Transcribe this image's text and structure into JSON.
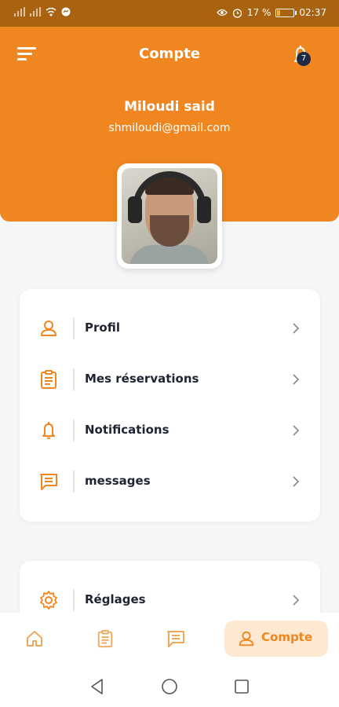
{
  "status_bar": {
    "battery_percent": "17 %",
    "battery_level": 0.17,
    "time": "02:37",
    "left_icons": [
      "signal-icon",
      "signal-icon",
      "wifi-icon",
      "messenger-icon"
    ],
    "right_icons": [
      "eye-icon",
      "alarm-icon"
    ]
  },
  "header": {
    "title": "Compte",
    "notification_count": "7",
    "user_name": "Miloudi said",
    "user_email": "shmiloudi@gmail.com"
  },
  "menu": {
    "items": [
      {
        "label": "Profil",
        "icon": "user-icon"
      },
      {
        "label": "Mes réservations",
        "icon": "clipboard-icon"
      },
      {
        "label": "Notifications",
        "icon": "bell-icon"
      },
      {
        "label": "messages",
        "icon": "message-icon"
      }
    ]
  },
  "settings": {
    "items": [
      {
        "label": "Réglages",
        "icon": "gear-icon"
      }
    ]
  },
  "bottom_nav": {
    "items": [
      {
        "icon": "home-icon"
      },
      {
        "icon": "clipboard-icon"
      },
      {
        "icon": "message-icon"
      },
      {
        "icon": "user-icon",
        "label": "Compte",
        "active": true
      }
    ]
  },
  "colors": {
    "brand_orange": "#f0861f",
    "status_bar": "#a86210",
    "active_tab_bg": "#fde8d2",
    "badge": "#1f2b44"
  }
}
